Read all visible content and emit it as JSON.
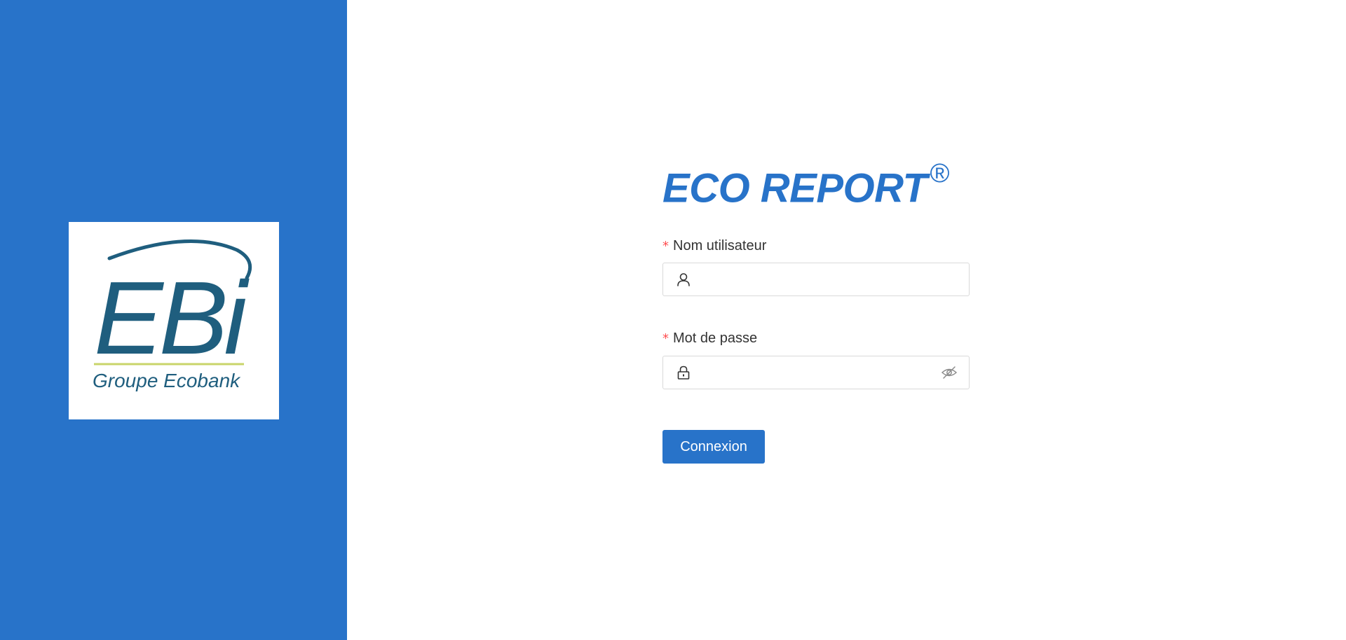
{
  "app": {
    "title": "ECO REPORT",
    "title_mark": "®",
    "accent_color": "#2873c9"
  },
  "logo": {
    "mark_text": "EBi",
    "group_text": "Groupe Ecobank",
    "mark_color": "#1f5e7e",
    "line_color": "#c9d46a"
  },
  "form": {
    "required_marker": "*",
    "username": {
      "label": "Nom utilisateur",
      "value": "",
      "placeholder": "",
      "icon": "user-icon"
    },
    "password": {
      "label": "Mot de passe",
      "value": "",
      "placeholder": "",
      "icon": "lock-icon",
      "toggle_icon": "eye-invisible-icon"
    },
    "submit_label": "Connexion"
  }
}
